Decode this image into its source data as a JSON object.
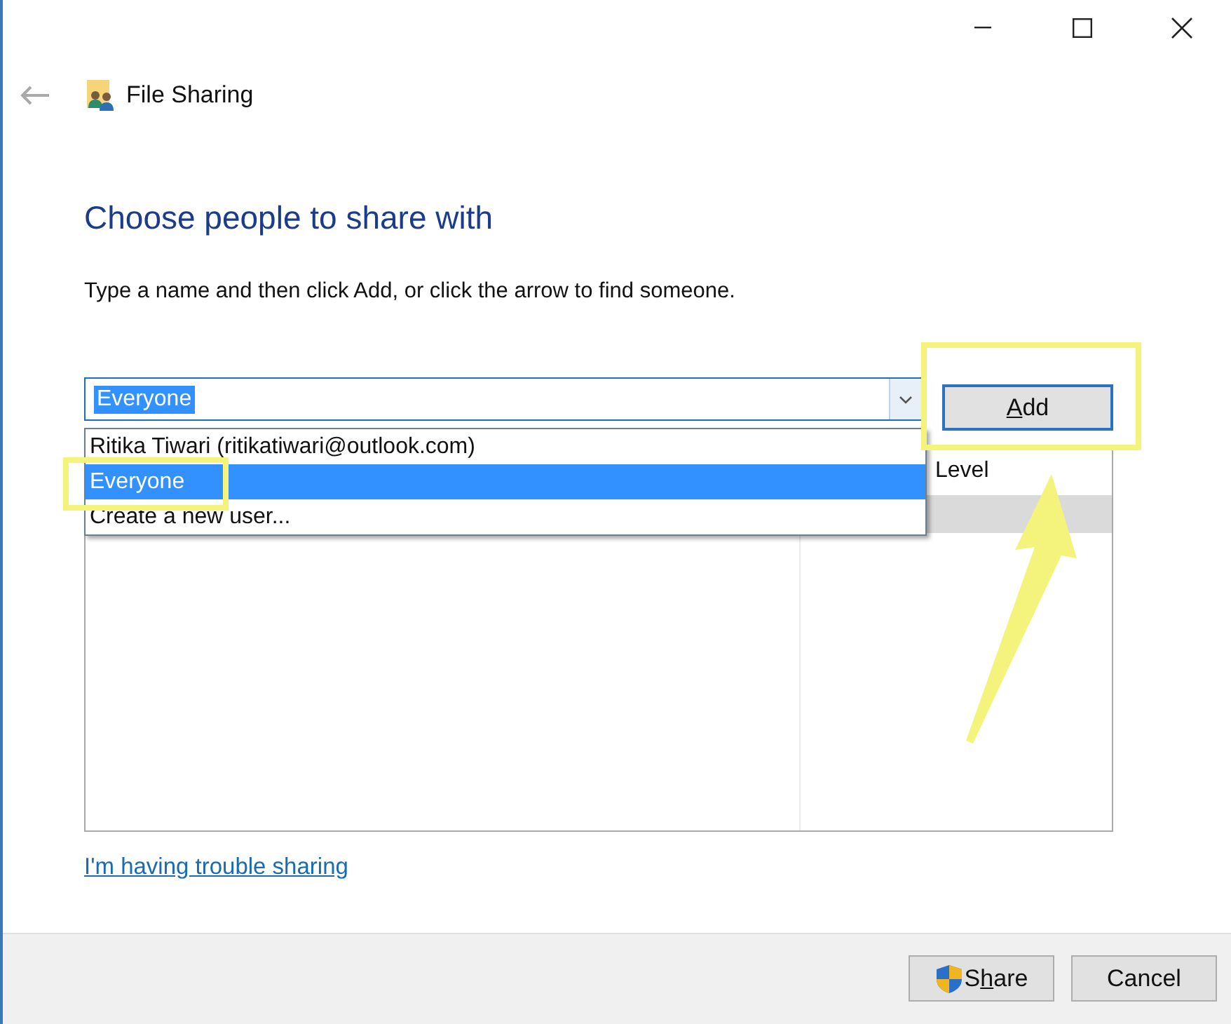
{
  "header": {
    "title": "File Sharing"
  },
  "heading": "Choose people to share with",
  "instruction": "Type a name and then click Add, or click the arrow to find someone.",
  "name_field": {
    "value": "Everyone",
    "text_selected": true
  },
  "add_button": {
    "mnemonic": "A",
    "after": "dd"
  },
  "dropdown": {
    "open": true,
    "items": [
      {
        "label": "Ritika Tiwari (ritikatiwari@outlook.com)",
        "selected": false
      },
      {
        "label": "Everyone",
        "selected": true
      },
      {
        "label": "Create a new user...",
        "selected": false
      }
    ]
  },
  "table": {
    "column_2": "Level",
    "rows": [
      {
        "selected": true
      }
    ]
  },
  "help_link": "I'm having trouble sharing",
  "buttons": [
    {
      "kind": "shield",
      "before": "S",
      "mnemonic": "h",
      "after": "are"
    },
    {
      "kind": "plain",
      "label": "Cancel"
    }
  ]
}
